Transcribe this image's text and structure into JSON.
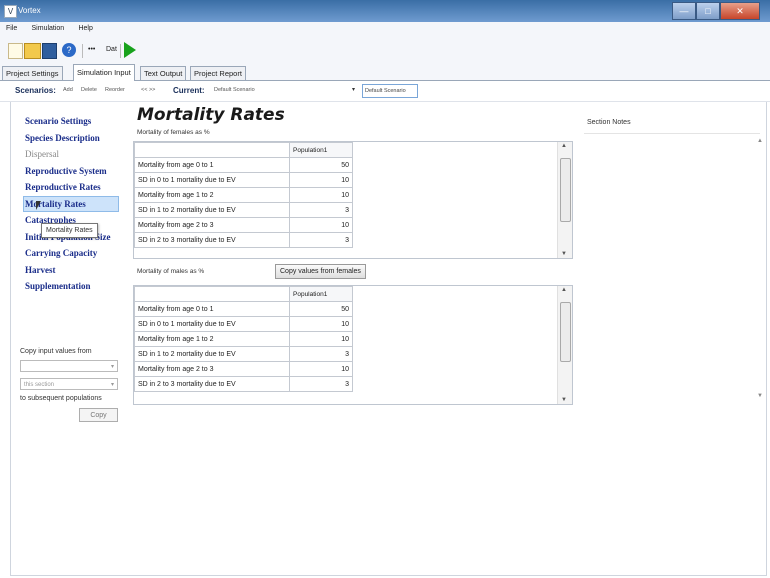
{
  "window": {
    "title": "Vortex",
    "app_icon": "V",
    "buttons": [
      "—",
      "□",
      "✕"
    ]
  },
  "menu": [
    "File",
    "Simulation",
    "Help"
  ],
  "toolbar": {
    "dots": "•••",
    "text_button": "Dat",
    "icons": [
      "new-file-icon",
      "open-folder-icon",
      "save-icon",
      "help-icon",
      "run-icon"
    ]
  },
  "tabs": [
    "Project Settings",
    "Simulation Input",
    "Text Output",
    "Project Report"
  ],
  "active_tab": "Simulation Input",
  "scenario_bar": {
    "label": "Scenarios:",
    "actions": [
      "Add",
      "Delete",
      "Reorder"
    ],
    "nav": "<<   >>",
    "current_label": "Current:",
    "current_value": "Default Scenario",
    "selected_box": "Default Scenario",
    "dropdown_arrow": "▾"
  },
  "sidebar": {
    "items": [
      {
        "label": "Scenario Settings",
        "state": "normal"
      },
      {
        "label": "Species Description",
        "state": "normal"
      },
      {
        "label": "Dispersal",
        "state": "disabled"
      },
      {
        "label": "Reproductive System",
        "state": "normal"
      },
      {
        "label": "Reproductive Rates",
        "state": "normal"
      },
      {
        "label": "Mortality Rates",
        "state": "selected"
      },
      {
        "label": "Catastrophes",
        "state": "normal"
      },
      {
        "label": "Initial Population Size",
        "state": "normal"
      },
      {
        "label": "Carrying Capacity",
        "state": "normal"
      },
      {
        "label": "Harvest",
        "state": "normal"
      },
      {
        "label": "Supplementation",
        "state": "normal"
      }
    ],
    "tooltip": "Mortality Rates",
    "copy_label": "Copy input values from",
    "select1": "",
    "select2": "this section",
    "subsequent": "to subsequent populations",
    "copy_button": "Copy"
  },
  "main": {
    "title": "Mortality Rates",
    "females_caption": "Mortality of females as %",
    "males_caption": "Mortality of males as %",
    "copy_from_females": "Copy values from females",
    "column_header": "Population1",
    "females_rows": [
      {
        "label": "Mortality from age 0 to 1",
        "value": "50"
      },
      {
        "label": "SD in 0 to 1 mortality due to EV",
        "value": "10"
      },
      {
        "label": "Mortality from age 1 to 2",
        "value": "10"
      },
      {
        "label": "SD in 1 to 2 mortality due to EV",
        "value": "3"
      },
      {
        "label": "Mortality from age 2 to 3",
        "value": "10"
      },
      {
        "label": "SD in 2 to 3 mortality due to EV",
        "value": "3"
      }
    ],
    "males_rows": [
      {
        "label": "Mortality from age 0 to 1",
        "value": "50"
      },
      {
        "label": "SD in 0 to 1 mortality due to EV",
        "value": "10"
      },
      {
        "label": "Mortality from age 1 to 2",
        "value": "10"
      },
      {
        "label": "SD in 1 to 2 mortality due to EV",
        "value": "3"
      },
      {
        "label": "Mortality from age 2 to 3",
        "value": "10"
      },
      {
        "label": "SD in 2 to 3 mortality due to EV",
        "value": "3"
      }
    ]
  },
  "notes": {
    "label": "Section Notes"
  },
  "scroll_glyphs": {
    "up": "▲",
    "down": "▼",
    "select": "▾"
  }
}
